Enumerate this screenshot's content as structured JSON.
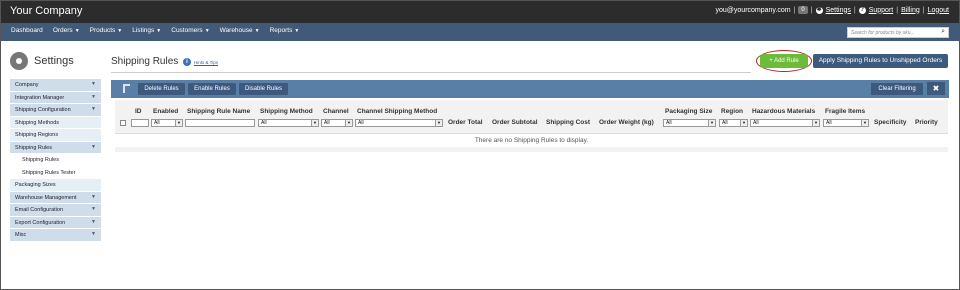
{
  "topbar": {
    "brand": "Your Company",
    "user_email": "you@yourcompany.com",
    "badge_count": "0",
    "settings": "Settings",
    "support": "Support",
    "billing": "Billing",
    "logout": "Logout"
  },
  "nav": {
    "items": [
      "Dashboard",
      "Orders",
      "Products",
      "Listings",
      "Customers",
      "Warehouse",
      "Reports"
    ],
    "search_placeholder": "Search for products by sku..."
  },
  "sidebar": {
    "title": "Settings",
    "items": [
      "Company",
      "Integration Manager",
      "Shipping Configuration",
      "Shipping Methods",
      "Shipping Regions",
      "Shipping Rules",
      "Shipping Rules",
      "Shipping Rules Tester",
      "Packaging Sizes",
      "Warehouse Management",
      "Email Configuration",
      "Export Configuration",
      "Misc"
    ]
  },
  "main": {
    "title": "Shipping Rules",
    "hints": "Hints & Tips",
    "add_rule": "+ Add Rule",
    "apply_rules": "Apply Shipping Rules to Unshipped Orders",
    "toolbar": {
      "delete": "Delete Rules",
      "enable": "Enable Rules",
      "disable": "Disable Rules",
      "clear": "Clear Filtering"
    },
    "columns": [
      "ID",
      "Enabled",
      "Shipping Rule Name",
      "Shipping Method",
      "Channel",
      "Channel Shipping Method",
      "Order Total",
      "Order Subtotal",
      "Shipping Cost",
      "Order Weight (kg)",
      "Packaging Size",
      "Region",
      "Hazardous Materials",
      "Fragile Items",
      "Specificity",
      "Priority"
    ],
    "filter_value": "All",
    "empty_message": "There are no Shipping Rules to display."
  },
  "colors": {
    "topbar": "#2c2c2c",
    "navbar": "#405a78",
    "add_button": "#6dbb3b",
    "toolbar": "#5a7fa6"
  }
}
